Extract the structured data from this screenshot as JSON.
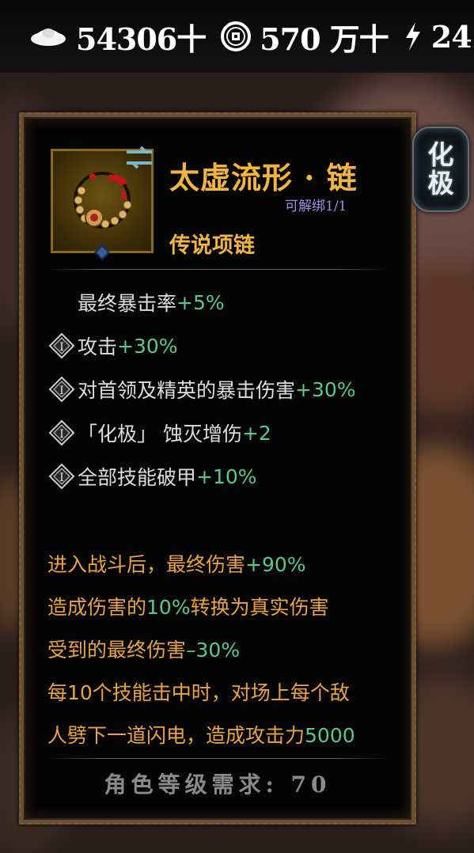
{
  "topbar": {
    "currencies": [
      {
        "icon": "silver-ingot-icon",
        "value": "54306十"
      },
      {
        "icon": "coin-icon",
        "value": "570 万十"
      },
      {
        "icon": "energy-bolt-icon",
        "value": "24"
      }
    ]
  },
  "item": {
    "name": "太虚流形 · 链",
    "bind_status": "可解绑1/1",
    "type": "传说项链",
    "badge_line1": "化",
    "badge_line2": "极",
    "stats": [
      {
        "label": "最终暴击率",
        "value": "+5%",
        "icon": ""
      },
      {
        "label": "攻击",
        "value": "+30%",
        "icon": "rune-icon"
      },
      {
        "label": "对首领及精英的暴击伤害",
        "value": "+30%",
        "icon": "rune-icon"
      },
      {
        "label": "「化极」 蚀灭增伤",
        "value": "+2",
        "icon": "rune-icon"
      },
      {
        "label": "全部技能破甲",
        "value": "+10%",
        "icon": "rune-icon"
      }
    ],
    "effects": [
      {
        "pre": "进入战斗后，最终伤害",
        "val": "+90%",
        "post": ""
      },
      {
        "pre": "造成伤害的",
        "val": "10%",
        "post": "转换为真实伤害"
      },
      {
        "pre": "受到的最终伤害",
        "val": "–30%",
        "post": ""
      },
      {
        "pre": "每10个技能击中时，对场上每个敌",
        "val": "",
        "post": ""
      },
      {
        "pre": "人劈下一道闪电，造成攻击力",
        "val": "5000",
        "post": ""
      }
    ],
    "requirement": "角色等级需求: 70"
  },
  "colors": {
    "gold": "#f2b441",
    "green": "#57c98a",
    "orange": "#e9a441",
    "purple": "#9f8ee0"
  }
}
